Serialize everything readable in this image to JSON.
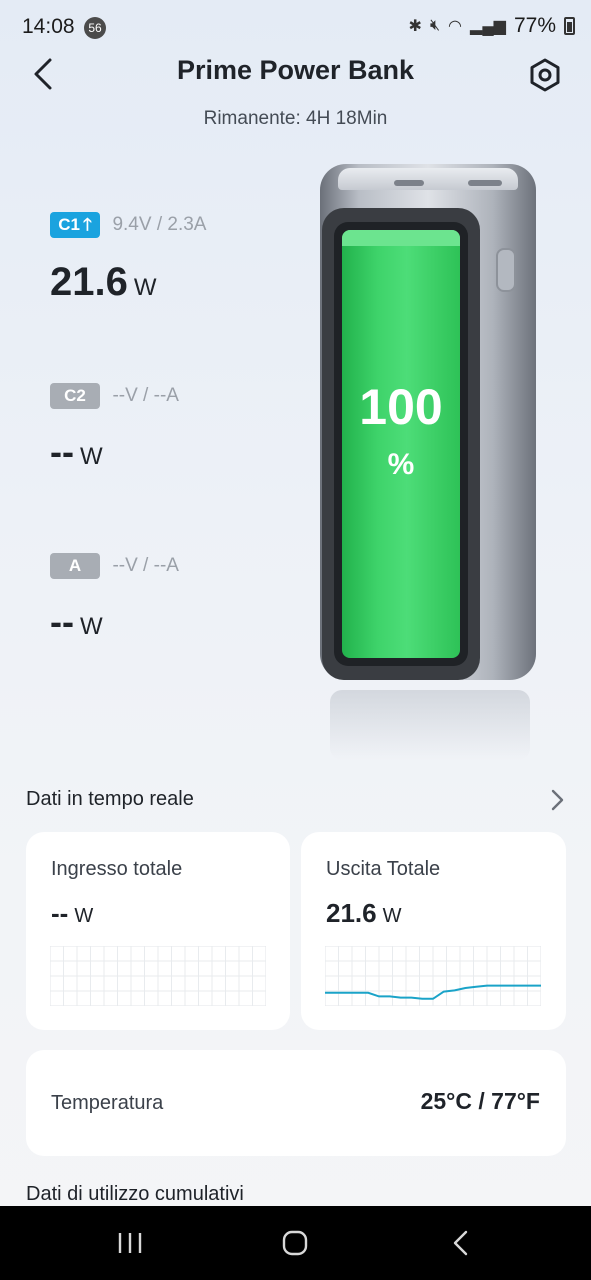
{
  "status_bar": {
    "time": "14:08",
    "notification_count": "56",
    "battery_percent": "77%"
  },
  "header": {
    "title": "Prime Power Bank",
    "remaining": "Rimanente: 4H 18Min"
  },
  "ports": [
    {
      "label": "C1",
      "direction_icon": "arrow-up-icon",
      "vi": "9.4V / 2.3A",
      "power": "21.6",
      "unit": "W",
      "active": true
    },
    {
      "label": "C2",
      "vi": "--V / --A",
      "power": "--",
      "unit": "W",
      "active": false
    },
    {
      "label": "A",
      "vi": "--V / --A",
      "power": "--",
      "unit": "W",
      "active": false
    }
  ],
  "battery": {
    "percent": "100",
    "percent_sign": "%",
    "level": 1.0,
    "color": "#3ed36a"
  },
  "realtime": {
    "title": "Dati in tempo reale",
    "input": {
      "label": "Ingresso totale",
      "value": "--",
      "unit": "W"
    },
    "output": {
      "label": "Uscita Totale",
      "value": "21.6",
      "unit": "W",
      "trend": [
        0.22,
        0.22,
        0.22,
        0.22,
        0.22,
        0.16,
        0.16,
        0.14,
        0.14,
        0.12,
        0.12,
        0.24,
        0.26,
        0.3,
        0.32,
        0.34,
        0.34,
        0.34,
        0.34,
        0.34,
        0.34
      ],
      "line_color": "#1aa3c8"
    },
    "temperature": {
      "label": "Temperatura",
      "value": "25°C / 77°F"
    }
  },
  "cumulative": {
    "title": "Dati di utilizzo cumulativi"
  },
  "colors": {
    "accent": "#1aa3df",
    "inactive_badge": "#a8adb4"
  }
}
